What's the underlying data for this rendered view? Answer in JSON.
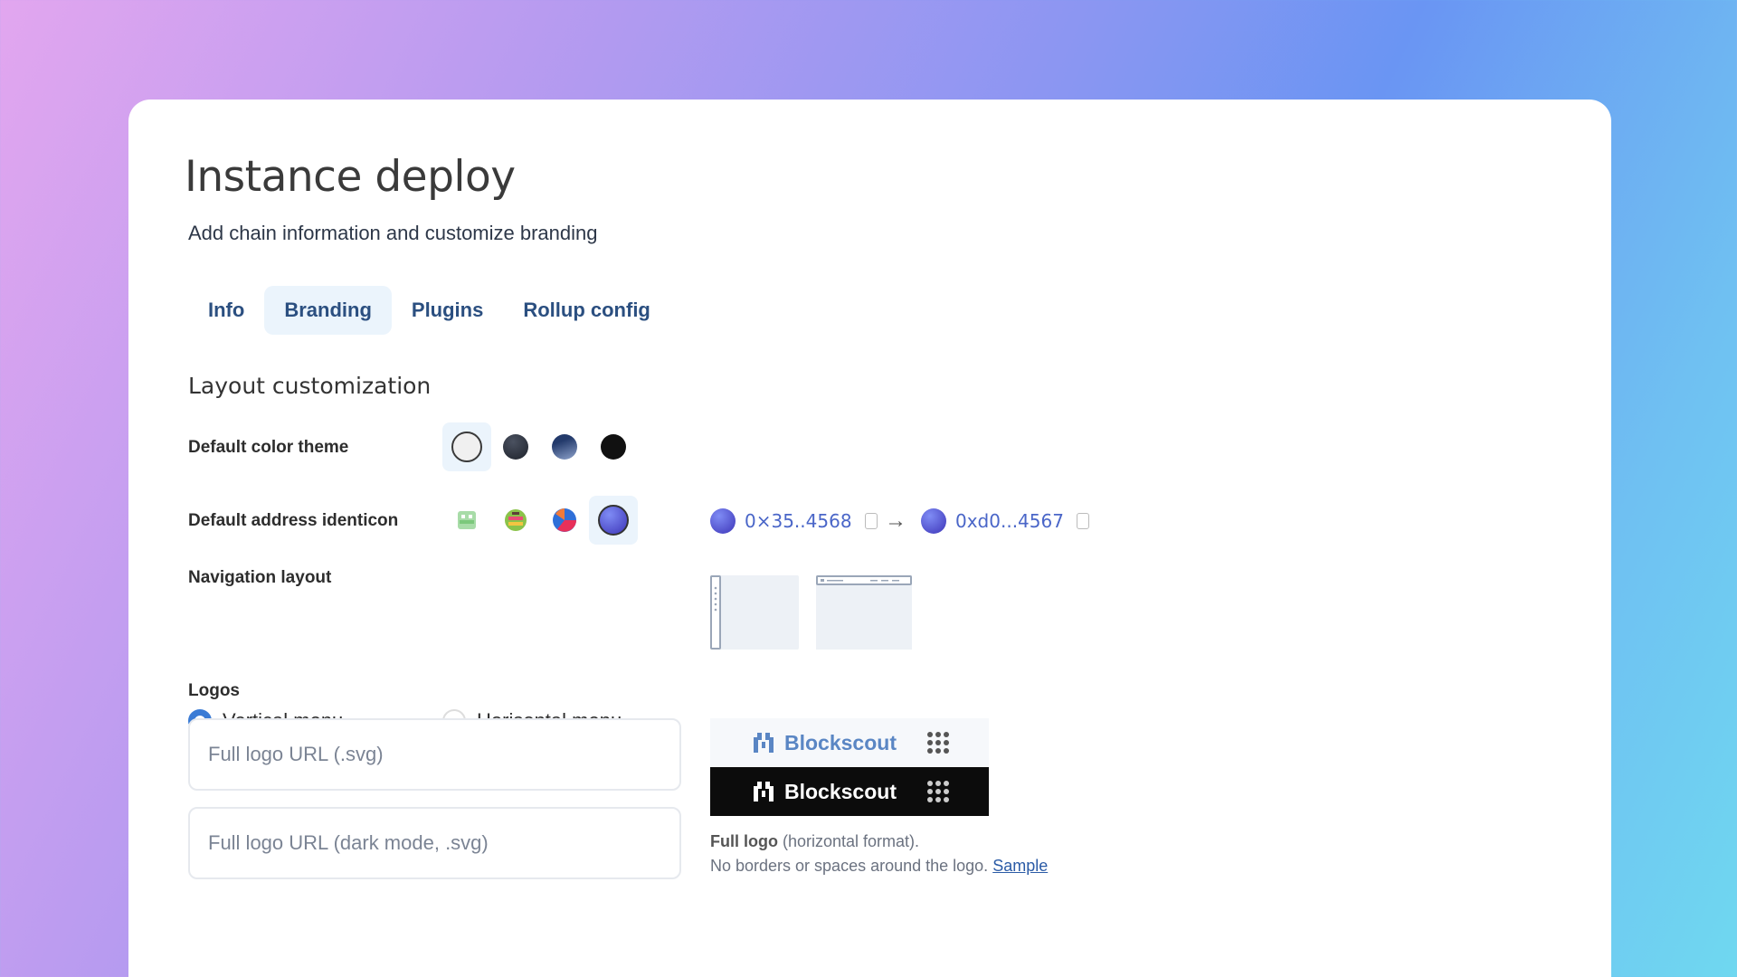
{
  "page": {
    "title": "Instance deploy",
    "subtitle": "Add chain information and customize branding"
  },
  "tabs": [
    {
      "label": "Info",
      "active": false
    },
    {
      "label": "Branding",
      "active": true
    },
    {
      "label": "Plugins",
      "active": false
    },
    {
      "label": "Rollup config",
      "active": false
    }
  ],
  "layout": {
    "section_title": "Layout customization",
    "color_theme_label": "Default color theme",
    "color_themes": [
      "light",
      "dim",
      "midnight",
      "dark"
    ],
    "selected_theme": "light",
    "identicon_label": "Default address identicon",
    "identicons": [
      "jazzicon-green",
      "github-pixel",
      "blockie",
      "gradient-avatar"
    ],
    "selected_identicon": "gradient-avatar",
    "address_from": "0×35..4568",
    "address_to": "0xd0...4567",
    "nav_label": "Navigation layout",
    "nav_options": [
      {
        "label": "Vertical menu",
        "checked": true
      },
      {
        "label": "Horisontal menu",
        "checked": false
      }
    ]
  },
  "logos": {
    "label": "Logos",
    "full_logo_placeholder": "Full logo URL (.svg)",
    "full_logo_dark_placeholder": "Full logo URL (dark mode, .svg)",
    "brand_name": "Blockscout",
    "note_bold": "Full logo",
    "note_rest": " (horizontal format).",
    "note_line2": "No borders or spaces around the logo.",
    "sample_link": "Sample"
  },
  "colors": {
    "accent": "#3a7bd5",
    "tab_text": "#2b4f80",
    "tab_active_bg": "#ebf4fc"
  }
}
